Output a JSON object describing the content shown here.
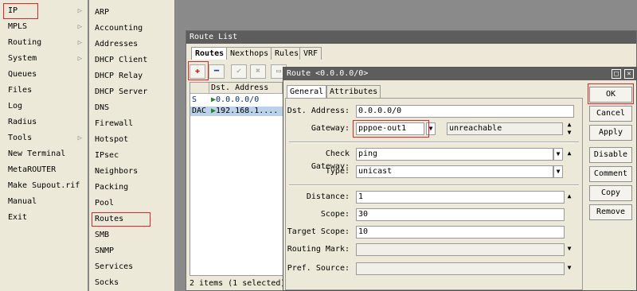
{
  "menu_left": {
    "items": [
      {
        "label": "IP",
        "arrow": "▷"
      },
      {
        "label": "MPLS",
        "arrow": "▷"
      },
      {
        "label": "Routing",
        "arrow": "▷"
      },
      {
        "label": "System",
        "arrow": "▷"
      },
      {
        "label": "Queues",
        "arrow": ""
      },
      {
        "label": "Files",
        "arrow": ""
      },
      {
        "label": "Log",
        "arrow": ""
      },
      {
        "label": "Radius",
        "arrow": ""
      },
      {
        "label": "Tools",
        "arrow": "▷"
      },
      {
        "label": "New Terminal",
        "arrow": ""
      },
      {
        "label": "MetaROUTER",
        "arrow": ""
      },
      {
        "label": "Make Supout.rif",
        "arrow": ""
      },
      {
        "label": "Manual",
        "arrow": ""
      },
      {
        "label": "Exit",
        "arrow": ""
      }
    ]
  },
  "menu_ip": {
    "items": [
      "ARP",
      "Accounting",
      "Addresses",
      "DHCP Client",
      "DHCP Relay",
      "DHCP Server",
      "DNS",
      "Firewall",
      "Hotspot",
      "IPsec",
      "Neighbors",
      "Packing",
      "Pool",
      "Routes",
      "SMB",
      "SNMP",
      "Services",
      "Socks"
    ]
  },
  "route_list": {
    "title": "Route List",
    "tabs": [
      "Routes",
      "Nexthops",
      "Rules",
      "VRF"
    ],
    "toolbar": {
      "add": "✚",
      "remove": "━",
      "enable": "✔",
      "disable": "✖",
      "comment": "▭"
    },
    "grid": {
      "columns": [
        "",
        "Dst. Address"
      ],
      "rows": [
        {
          "flags": "S",
          "dst": "0.0.0.0/0"
        },
        {
          "flags": "DAC",
          "dst": "192.168.1...."
        }
      ]
    },
    "status": "2 items (1 selected)"
  },
  "route_dialog": {
    "title": "Route <0.0.0.0/0>",
    "tabs": [
      "General",
      "Attributes"
    ],
    "fields": {
      "dst_label": "Dst. Address:",
      "dst_value": "0.0.0.0/0",
      "gw_label": "Gateway:",
      "gw_value": "pppoe-out1",
      "gw_state": "unreachable",
      "checkgw_label": "Check Gateway:",
      "checkgw_value": "ping",
      "type_label": "Type:",
      "type_value": "unicast",
      "distance_label": "Distance:",
      "distance_value": "1",
      "scope_label": "Scope:",
      "scope_value": "30",
      "tscope_label": "Target Scope:",
      "tscope_value": "10",
      "rmark_label": "Routing Mark:",
      "rmark_value": "",
      "psrc_label": "Pref. Source:",
      "psrc_value": ""
    },
    "buttons": [
      "OK",
      "Cancel",
      "Apply",
      "Disable",
      "Comment",
      "Copy",
      "Remove"
    ]
  }
}
